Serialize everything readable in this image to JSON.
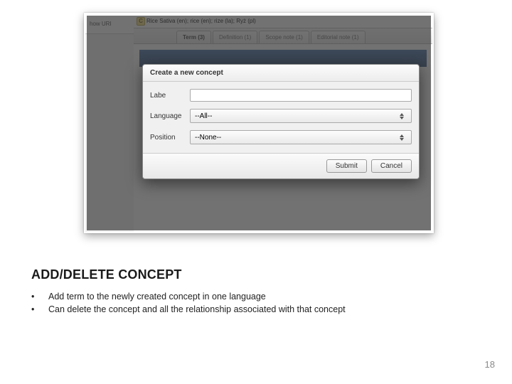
{
  "slide": {
    "heading": "ADD/DELETE CONCEPT",
    "bullets": [
      "Add term to the newly created concept in one language",
      "Can delete the concept and all the relationship associated with that concept"
    ],
    "page_number": "18"
  },
  "app": {
    "left_panel_link": "how URI",
    "concept_title": "Rice Sativa (en); rice (en); rize (la); Ryż (pl)",
    "concept_icon_letter": "C",
    "tabs": [
      {
        "label": "Term (3)"
      },
      {
        "label": "Definition (1)"
      },
      {
        "label": "Scope note (1)"
      },
      {
        "label": "Editorial note (1)"
      }
    ]
  },
  "dialog": {
    "title": "Create a new concept",
    "fields": {
      "label_label": "Labe",
      "label_value": "",
      "language_label": "Language",
      "language_value": "--All--",
      "position_label": "Position",
      "position_value": "--None--"
    },
    "buttons": {
      "submit": "Submit",
      "cancel": "Cancel"
    }
  }
}
